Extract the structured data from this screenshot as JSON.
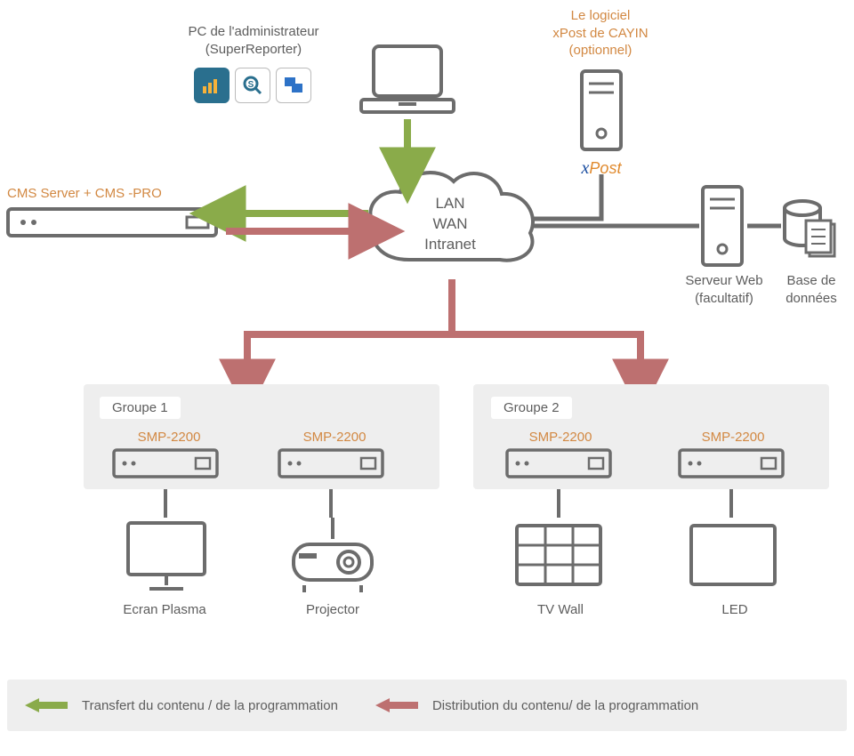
{
  "admin": {
    "line1": "PC de l'administrateur",
    "line2": "(SuperReporter)"
  },
  "xpost": {
    "line1": "Le logiciel",
    "line2": "xPost de CAYIN",
    "line3": "(optionnel)",
    "logo": "xPost"
  },
  "cloud": {
    "line1": "LAN",
    "line2": "WAN",
    "line3": "Intranet"
  },
  "cms": {
    "label": "CMS Server + CMS -PRO"
  },
  "webserver": {
    "line1": "Serveur Web",
    "line2": "(facultatif)"
  },
  "database": {
    "line1": "Base de",
    "line2": "données"
  },
  "groups": {
    "g1": {
      "tab": "Groupe 1",
      "p1": "SMP-2200",
      "p2": "SMP-2200",
      "d1": "Ecran Plasma",
      "d2": "Projector"
    },
    "g2": {
      "tab": "Groupe 2",
      "p1": "SMP-2200",
      "p2": "SMP-2200",
      "d1": "TV Wall",
      "d2": "LED"
    }
  },
  "legend": {
    "transfer": "Transfert du contenu / de la programmation",
    "distribution": "Distribution du contenu/ de la programmation"
  },
  "colors": {
    "green": "#8aab4a",
    "red": "#bd7070",
    "stroke": "#6c6c6c",
    "orange": "#d28842"
  }
}
